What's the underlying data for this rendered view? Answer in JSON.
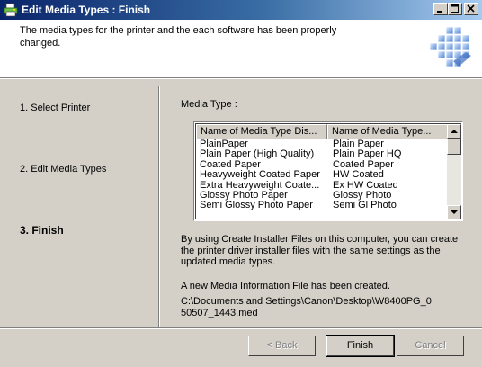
{
  "window": {
    "title": "Edit Media Types : Finish"
  },
  "header": {
    "description": "The media types for the printer and the each software has been properly changed."
  },
  "steps": [
    {
      "label": "1.  Select Printer",
      "active": false
    },
    {
      "label": "2.  Edit Media Types",
      "active": false
    },
    {
      "label": "3.  Finish",
      "active": true
    }
  ],
  "media": {
    "label": "Media Type :",
    "columns": [
      "Name of Media Type Dis...",
      "Name of Media Type..."
    ],
    "rows": [
      [
        "PlainPaper",
        "Plain Paper"
      ],
      [
        "Plain Paper (High Quality)",
        "Plain Paper HQ"
      ],
      [
        "Coated Paper",
        "Coated Paper"
      ],
      [
        "Heavyweight Coated Paper",
        "HW Coated"
      ],
      [
        "Extra Heavyweight Coate...",
        "Ex HW Coated"
      ],
      [
        "Glossy Photo Paper",
        "Glossy Photo"
      ],
      [
        "Semi Glossy Photo Paper",
        "Semi Gl Photo"
      ]
    ]
  },
  "info": {
    "installer_text": "By using Create Installer Files on this computer, you can create the printer driver installer files with the same settings as the updated media types.",
    "created_text": "A new Media Information File has been created.",
    "file_path": "C:\\Documents and Settings\\Canon\\Desktop\\W8400PG_050507_1443.med",
    "file_path_line1": "C:\\Documents and Settings\\Canon\\Desktop\\W8400PG_0",
    "file_path_line2": "50507_1443.med"
  },
  "buttons": {
    "back": "< Back",
    "finish": "Finish",
    "cancel": "Cancel"
  },
  "icons": {
    "app": "printer-app-icon",
    "header": "printer-grid-icon",
    "minimize": "minimize-icon",
    "maximize": "maximize-icon",
    "close": "close-icon"
  }
}
